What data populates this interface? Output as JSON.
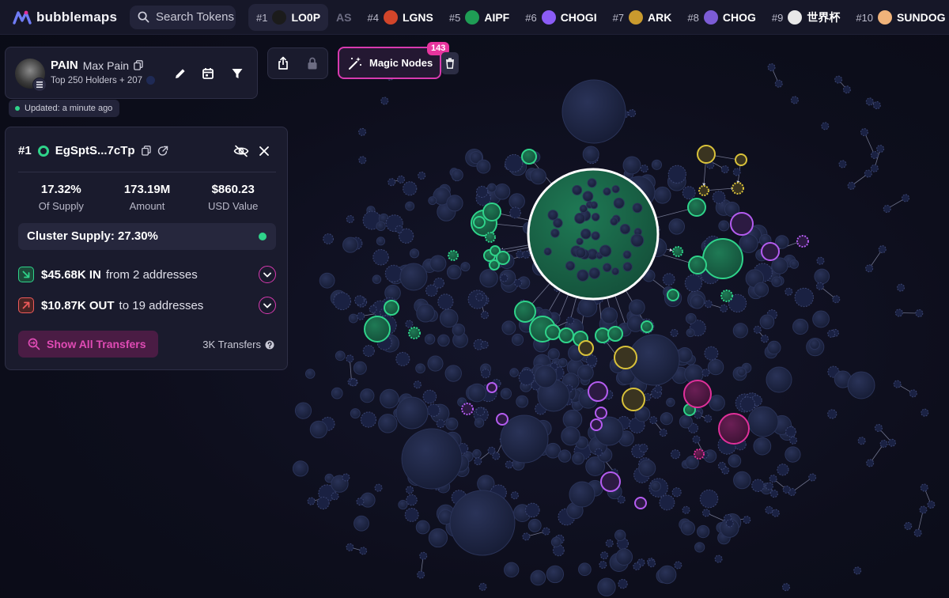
{
  "app": {
    "name": "bubblemaps"
  },
  "search": {
    "placeholder": "Search Tokens"
  },
  "tickers": [
    {
      "rank": "#1",
      "symbol": "LO0P",
      "color": "#1b1b1b",
      "active": true
    },
    {
      "rank": "",
      "symbol": "AS",
      "color": "",
      "faded": true
    },
    {
      "rank": "#4",
      "symbol": "LGNS",
      "color": "#d2452a"
    },
    {
      "rank": "#5",
      "symbol": "AIPF",
      "color": "#1f9d55"
    },
    {
      "rank": "#6",
      "symbol": "CHOGI",
      "color": "#8b5cf6"
    },
    {
      "rank": "#7",
      "symbol": "ARK",
      "color": "#c99a2e"
    },
    {
      "rank": "#8",
      "symbol": "CHOG",
      "color": "#7c5cd6"
    },
    {
      "rank": "#9",
      "symbol": "世界杯",
      "color": "#e8e8e8"
    },
    {
      "rank": "#10",
      "symbol": "SUNDOG",
      "color": "#f0b37a"
    }
  ],
  "token": {
    "symbol": "PAIN",
    "name": "Max Pain",
    "subtitle": "Top 250 Holders + 207",
    "updated": "Updated: a minute ago"
  },
  "magic_nodes": {
    "label": "Magic Nodes",
    "count": "143"
  },
  "wallet": {
    "rank": "#1",
    "address": "EgSptS...7cTp",
    "stats": [
      {
        "value": "17.32%",
        "label": "Of Supply"
      },
      {
        "value": "173.19M",
        "label": "Amount"
      },
      {
        "value": "$860.23",
        "label": "USD Value"
      }
    ],
    "cluster_supply": "Cluster Supply: 27.30%",
    "flow_in": {
      "amount": "$45.68K IN",
      "rest": "from 2 addresses"
    },
    "flow_out": {
      "amount": "$10.87K OUT",
      "rest": "to 19 addresses"
    },
    "show_all": "Show All Transfers",
    "transfers": "3K Transfers"
  },
  "colors": {
    "accent": "#d83ab0",
    "green": "#2fd38a",
    "yellow": "#d9c23a",
    "purple": "#b45cf0",
    "magenta": "#e0309a",
    "bubble": "#1c2340"
  }
}
